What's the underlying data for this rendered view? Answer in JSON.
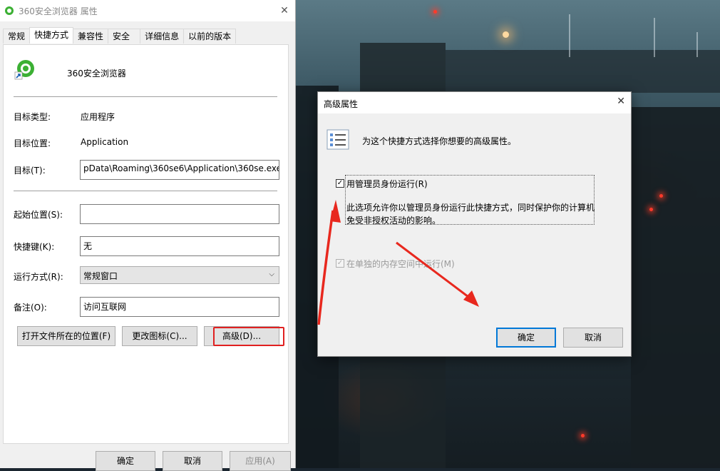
{
  "properties_window": {
    "title": "360安全浏览器 属性",
    "tabs": [
      {
        "label": "常规"
      },
      {
        "label": "快捷方式"
      },
      {
        "label": "兼容性"
      },
      {
        "label": "安全"
      },
      {
        "label": "详细信息"
      },
      {
        "label": "以前的版本"
      }
    ],
    "active_tab": "快捷方式",
    "app_name": "360安全浏览器",
    "target_type_label": "目标类型:",
    "target_type_value": "应用程序",
    "target_location_label": "目标位置:",
    "target_location_value": "Application",
    "target_label": "目标(T):",
    "target_value": "pData\\Roaming\\360se6\\Application\\360se.exe",
    "start_in_label": "起始位置(S):",
    "start_in_value": "",
    "shortcut_key_label": "快捷键(K):",
    "shortcut_key_value": "无",
    "run_label": "运行方式(R):",
    "run_value": "常规窗口",
    "comment_label": "备注(O):",
    "comment_value": "访问互联网",
    "open_location_button": "打开文件所在的位置(F)",
    "change_icon_button": "更改图标(C)...",
    "advanced_button": "高级(D)...",
    "ok_button": "确定",
    "cancel_button": "取消",
    "apply_button": "应用(A)"
  },
  "advanced_dialog": {
    "title": "高级属性",
    "description": "为这个快捷方式选择你想要的高级属性。",
    "run_as_admin_label": "用管理员身份运行(R)",
    "run_as_admin_checked": true,
    "run_as_admin_desc_line1": "此选项允许你以管理员身份运行此快捷方式，同时保护你的计算机",
    "run_as_admin_desc_line2": "免受非授权活动的影响。",
    "separate_memory_label": "在单独的内存空间中运行(M)",
    "separate_memory_checked": true,
    "separate_memory_enabled": false,
    "ok_button": "确定",
    "cancel_button": "取消"
  },
  "icons": {
    "window_icon": "360-browser-icon",
    "close_icon": "close-icon",
    "dropdown_icon": "chevron-down-icon",
    "properties_list_icon": "checklist-icon",
    "checkbox_mark": "✓"
  },
  "colors": {
    "highlight_red": "#e02020",
    "arrow_red": "#e8281e",
    "focus_blue": "#0078d7",
    "brand_green": "#3cb034"
  }
}
